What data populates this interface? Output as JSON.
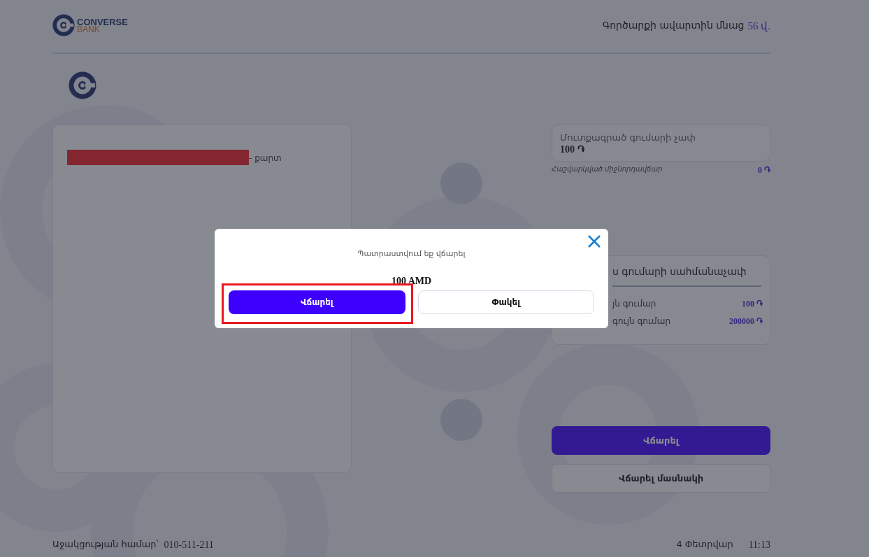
{
  "header": {
    "logo_top": "CONVERSE",
    "logo_bottom": "BANK",
    "timer_label": "Գործարքի ավարտին մնաց",
    "timer_value": "56 վ."
  },
  "card_panel": {
    "card_suffix": "- քարտ"
  },
  "amount_field": {
    "label": "Մուտքագրած գումարի չափ",
    "value": "100 ֏"
  },
  "commission": {
    "label": "Հաշվարկված միջնորդավճար",
    "value": "0 ֏"
  },
  "limits": {
    "title": "ս գումարի սահմանաչափ",
    "rows": [
      {
        "label": "յն գումար",
        "value": "100 ֏"
      },
      {
        "label": "գույն գումար",
        "value": "200000 ֏"
      }
    ]
  },
  "actions": [
    {
      "label": "Վճարել",
      "kind": "primary"
    },
    {
      "label": "Վճարել մասնակի",
      "kind": "secondary"
    }
  ],
  "footer": {
    "support_label": "Աջակցության համար՝",
    "support_phone": "010-511-211",
    "date": "4 Փետրվար",
    "time": "11:13"
  },
  "dialog": {
    "message": "Պատրաստվում եք վճարել",
    "amount": "100 AMD",
    "buttons": [
      {
        "label": "Վճարել",
        "kind": "primary",
        "highlighted": true
      },
      {
        "label": "Փակել",
        "kind": "secondary",
        "highlighted": false
      }
    ]
  }
}
